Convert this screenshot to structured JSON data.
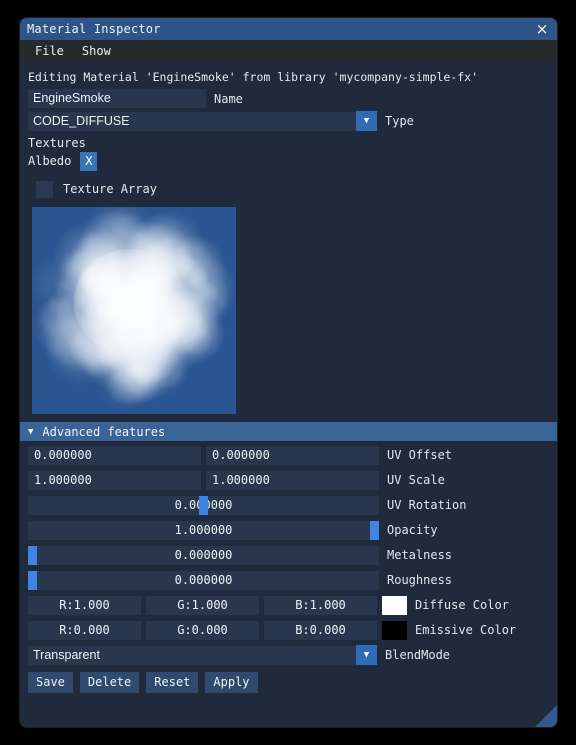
{
  "window": {
    "title": "Material Inspector",
    "close_icon": "close-icon",
    "close_glyph": "×"
  },
  "menubar": {
    "items": [
      {
        "label": "File"
      },
      {
        "label": "Show"
      }
    ]
  },
  "header": {
    "editing_line": "Editing Material 'EngineSmoke' from library 'mycompany-simple-fx'"
  },
  "name_row": {
    "value": "EngineSmoke",
    "placeholder": "Name",
    "label": "Name"
  },
  "type_row": {
    "value": "CODE_DIFFUSE",
    "label": "Type",
    "arrow_glyph": "▼"
  },
  "textures": {
    "section_label": "Textures",
    "albedo_label": "Albedo",
    "albedo_clear_label": "X",
    "texture_array_label": "Texture Array",
    "texture_array_checked": false,
    "preview_bg": "#2a5592"
  },
  "advanced": {
    "caret_glyph": "▼",
    "title": "Advanced features",
    "pair_rows": [
      {
        "label": "UV Offset",
        "x": "0.000000",
        "y": "0.000000"
      },
      {
        "label": "UV Scale",
        "x": "1.000000",
        "y": "1.000000"
      }
    ],
    "slider_rows": [
      {
        "label": "UV Rotation",
        "value": "0.000000",
        "fraction": 0.5
      },
      {
        "label": "Opacity",
        "value": "1.000000",
        "fraction": 1.0
      },
      {
        "label": "Metalness",
        "value": "0.000000",
        "fraction": 0.0
      },
      {
        "label": "Roughness",
        "value": "0.000000",
        "fraction": 0.0
      }
    ],
    "color_rows": [
      {
        "label": "Diffuse Color",
        "r": "R:1.000",
        "g": "G:1.000",
        "b": "B:1.000",
        "swatch": "#ffffff"
      },
      {
        "label": "Emissive Color",
        "r": "R:0.000",
        "g": "G:0.000",
        "b": "B:0.000",
        "swatch": "#000000"
      }
    ]
  },
  "blend_row": {
    "value": "Transparent",
    "label": "BlendMode",
    "arrow_glyph": "▼"
  },
  "buttons": [
    {
      "label": "Save"
    },
    {
      "label": "Delete"
    },
    {
      "label": "Reset"
    },
    {
      "label": "Apply"
    }
  ],
  "colors": {
    "titlebar": "#2f5588",
    "menubar": "#26292d",
    "panel": "#1f2b3d",
    "field": "#28374d",
    "accent": "#3d85e0",
    "section_header": "#3a6396",
    "button": "#2f4a6d"
  }
}
